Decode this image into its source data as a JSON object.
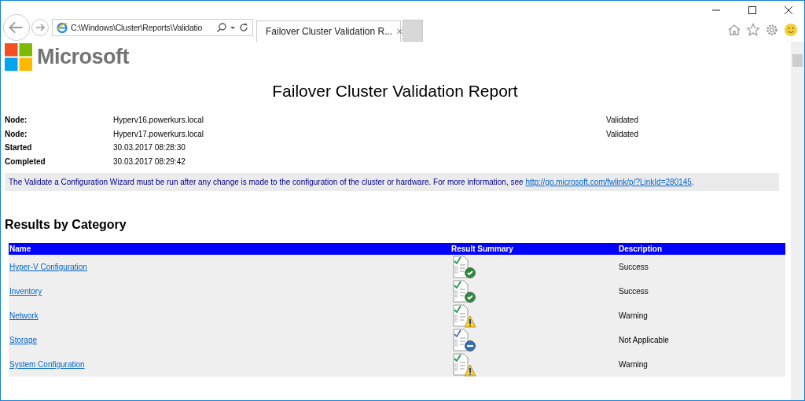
{
  "address_bar": {
    "value": "C:\\Windows\\Cluster\\Reports\\Validatio"
  },
  "tab": {
    "title": "Failover Cluster Validation R...",
    "close": "×",
    "selected": true
  },
  "logo": {
    "text": "Microsoft"
  },
  "report": {
    "title": "Failover Cluster Validation Report",
    "details": [
      {
        "label": "Node:",
        "value": "Hyperv16.powerkurs.local",
        "status": "Validated"
      },
      {
        "label": "Node:",
        "value": "Hyperv17.powerkurs.local",
        "status": "Validated"
      },
      {
        "label": "Started",
        "value": "30.03.2017 08:28:30"
      },
      {
        "label": "Completed",
        "value": "30.03.2017 08:29:42"
      }
    ],
    "notice": {
      "text": "The Validate a Configuration Wizard must be run after any change is made to the configuration of the cluster or hardware. For more information, see ",
      "link": "http://go.microsoft.com/fwlink/p/?LinkId=280145",
      "end": "."
    }
  },
  "results": {
    "heading": "Results by Category",
    "columns": [
      "Name",
      "Result Summary",
      "Description"
    ],
    "rows": [
      {
        "name": "Hyper-V Configuration",
        "kind": "success",
        "description": "Success"
      },
      {
        "name": "Inventory",
        "kind": "success",
        "description": "Success"
      },
      {
        "name": "Network",
        "kind": "warning",
        "description": "Warning"
      },
      {
        "name": "Storage",
        "kind": "not_applicable",
        "description": "Not Applicable"
      },
      {
        "name": "System Configuration",
        "kind": "warning",
        "description": "Warning"
      }
    ]
  }
}
